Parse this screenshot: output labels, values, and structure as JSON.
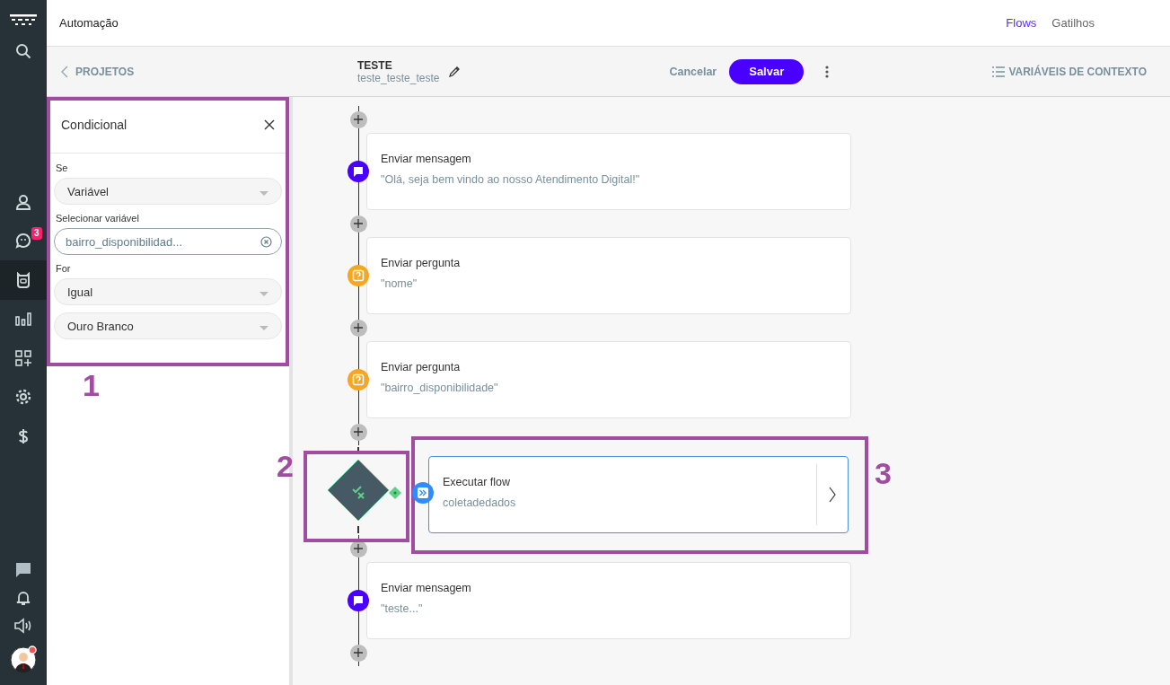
{
  "app": {
    "title": "Automação"
  },
  "nav_tabs": [
    {
      "label": "Flows",
      "selected": true
    },
    {
      "label": "Gatilhos",
      "selected": false
    }
  ],
  "sidebar": {
    "top_items": [
      {
        "selected": false
      },
      {
        "selected": false,
        "badge": "3"
      },
      {
        "selected": true
      },
      {
        "selected": false
      },
      {
        "selected": false
      },
      {
        "selected": false
      },
      {
        "selected": false
      }
    ]
  },
  "toolbar": {
    "back": "PROJETOS",
    "flow_name": "TESTE",
    "flow_id": "teste_teste_teste",
    "cancel": "Cancelar",
    "save": "Salvar",
    "context_variables": "VARIÁVEIS DE CONTEXTO"
  },
  "panel": {
    "title": "Condicional",
    "fields": [
      {
        "kind": "select",
        "label": "Se",
        "value": "Variável"
      },
      {
        "kind": "input",
        "label": "Selecionar variável",
        "value": "bairro_disponibilidad..."
      },
      {
        "kind": "select",
        "label": "For",
        "value": "Igual"
      },
      {
        "kind": "select",
        "value": "Ouro Branco"
      }
    ]
  },
  "steps": [
    {
      "kind": "message",
      "title": "Enviar mensagem",
      "detail": "\"Olá, seja bem vindo ao nosso Atendimento Digital!\""
    },
    {
      "kind": "question",
      "title": "Enviar pergunta",
      "detail": "\"nome\""
    },
    {
      "kind": "question",
      "title": "Enviar pergunta",
      "detail": "\"bairro_disponibilidade\""
    },
    {
      "kind": "condition",
      "title": "Executar flow",
      "detail": "coletadedados"
    },
    {
      "kind": "message",
      "title": "Enviar mensagem",
      "detail": "\"teste...\""
    }
  ],
  "annotations": [
    {
      "label": "1"
    },
    {
      "label": "2"
    },
    {
      "label": "3"
    }
  ]
}
